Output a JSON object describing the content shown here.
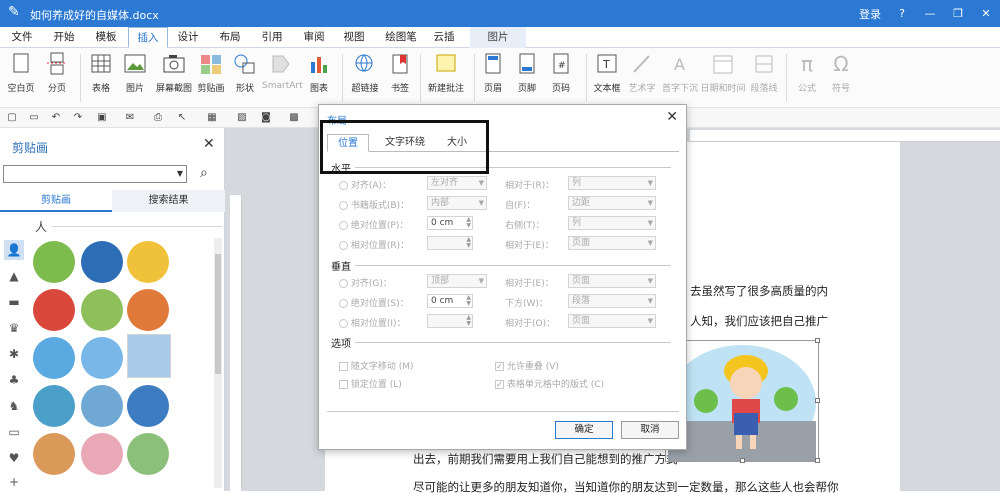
{
  "title_bar": {
    "doc_title": "如何养成好的自媒体.docx",
    "login": "登录",
    "help": "?",
    "minimize": "—",
    "restore": "❐",
    "close": "✕"
  },
  "menu": [
    "文件",
    "开始",
    "模板",
    "插入",
    "设计",
    "布局",
    "引用",
    "审阅",
    "视图",
    "绘图笔",
    "云插",
    "图片"
  ],
  "ribbon": {
    "buttons": [
      "空白页",
      "分页",
      "表格",
      "图片",
      "屏幕截图",
      "剪贴画",
      "形状",
      "SmartArt",
      "图表",
      "超链接",
      "书签",
      "新建批注",
      "页眉",
      "页脚",
      "页码",
      "文本框",
      "艺术字",
      "首字下沉",
      "日期和时间",
      "段落线",
      "公式",
      "符号"
    ]
  },
  "clip_pane": {
    "title": "剪贴画",
    "tabs": [
      "剪贴画",
      "搜索结果"
    ],
    "category": "人"
  },
  "dialog": {
    "title": "布局",
    "tabs": [
      "位置",
      "文字环绕",
      "大小"
    ],
    "horizontal": {
      "label": "水平",
      "align": {
        "label": "对齐",
        "key": "(A)：",
        "value": "左对齐",
        "rel_label": "相对于",
        "rel_key": "(R)：",
        "rel_value": "列"
      },
      "book": {
        "label": "书籍版式",
        "key": "(B)：",
        "value": "内部",
        "rel_label": "自",
        "rel_key": "(F)：",
        "rel_value": "边距"
      },
      "absolute": {
        "label": "绝对位置",
        "key": "(P)：",
        "value": "0 cm",
        "rel_label": "右侧",
        "rel_key": "(T)：",
        "rel_value": "列"
      },
      "relative": {
        "label": "相对位置",
        "key": "(R)：",
        "value": "",
        "rel_label": "相对于",
        "rel_key": "(E)：",
        "rel_value": "页面"
      }
    },
    "vertical": {
      "label": "垂直",
      "align": {
        "label": "对齐",
        "key": "(G)：",
        "value": "顶部",
        "rel_label": "相对于",
        "rel_key": "(E)：",
        "rel_value": "页面"
      },
      "absolute": {
        "label": "绝对位置",
        "key": "(S)：",
        "value": "0 cm",
        "rel_label": "下方",
        "rel_key": "(W)：",
        "rel_value": "段落"
      },
      "relative": {
        "label": "相对位置",
        "key": "(I)：",
        "value": "",
        "rel_label": "相对于",
        "rel_key": "(O)：",
        "rel_value": "页面"
      }
    },
    "options": {
      "label": "选项",
      "move_with_text": "随文字移动",
      "move_with_text_key": "(M)",
      "lock_anchor": "锁定位置",
      "lock_anchor_key": "(L)",
      "allow_overlap": "允许重叠",
      "allow_overlap_key": "(V)",
      "layout_in_cell": "表格单元格中的版式",
      "layout_in_cell_key": "(C)"
    },
    "ok": "确定",
    "cancel": "取消"
  },
  "document": {
    "line1": "去虽然写了很多高质量的内",
    "line2": "人知，我们应该把自己推广",
    "line3": "出去，前期我们需要用上我们自己能想到的推广方式",
    "line4": "尽可能的让更多的朋友知道你，当知道你的朋友达到一定数量，那么这些人也会帮你"
  },
  "colors": {
    "accent": "#2b79d2",
    "titlebar": "#2b79d2"
  }
}
